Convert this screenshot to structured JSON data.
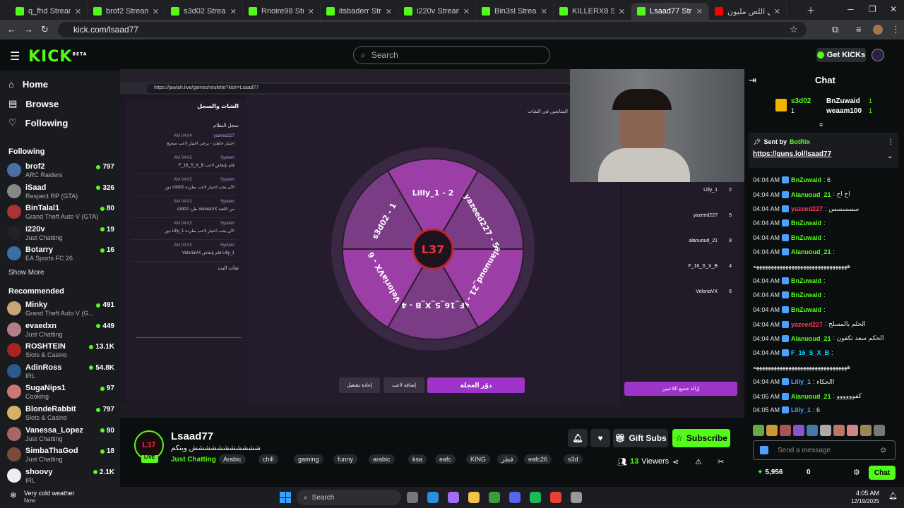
{
  "browser": {
    "tabs": [
      {
        "label": "q_fhd Stream - W",
        "type": "kick"
      },
      {
        "label": "brof2 Stream - W",
        "type": "kick"
      },
      {
        "label": "s3d02 Stream - W",
        "type": "kick"
      },
      {
        "label": "Rnoire98 Stream",
        "type": "kick"
      },
      {
        "label": "itsbaderr Stream",
        "type": "kick"
      },
      {
        "label": "i220v Stream - W",
        "type": "kick"
      },
      {
        "label": "Bin3sl Stream - W",
        "type": "kick"
      },
      {
        "label": "KILLERX8 Stream",
        "type": "kick"
      },
      {
        "label": "Lsaad77 Stream",
        "type": "kick",
        "active": true
      },
      {
        "label": "تحدي اللص مليون",
        "type": "youtube"
      }
    ],
    "url": "kick.com/lsaad77"
  },
  "header": {
    "logo": "KICK",
    "logo_sup": "BETA",
    "search_placeholder": "Search",
    "get_kicks": "Get KICKs"
  },
  "sidebar": {
    "nav": [
      {
        "label": "Home",
        "icon": "home-icon"
      },
      {
        "label": "Browse",
        "icon": "browse-icon"
      },
      {
        "label": "Following",
        "icon": "heart-icon"
      }
    ],
    "following_title": "Following",
    "following": [
      {
        "name": "brof2",
        "category": "ARC Raiders",
        "viewers": "797",
        "color": "#4a6fa5"
      },
      {
        "name": "iSaad",
        "category": "Respect RP (GTA)",
        "viewers": "326",
        "color": "#888"
      },
      {
        "name": "BinTalal1",
        "category": "Grand Theft Auto V (GTA)",
        "viewers": "80",
        "color": "#a33"
      },
      {
        "name": "i220v",
        "category": "Just Chatting",
        "viewers": "19",
        "color": "#222"
      },
      {
        "name": "Botarry",
        "category": "EA Sports FC 26",
        "viewers": "16",
        "color": "#3a6ea5"
      }
    ],
    "show_more": "Show More",
    "recommended_title": "Recommended",
    "recommended": [
      {
        "name": "Minky",
        "category": "Grand Theft Auto V (G...",
        "viewers": "491",
        "color": "#c9a57a"
      },
      {
        "name": "evaedxn",
        "category": "Just Chatting",
        "viewers": "449",
        "color": "#b57d8a"
      },
      {
        "name": "ROSHTEIN",
        "category": "Slots & Casino",
        "viewers": "13.1K",
        "color": "#a22"
      },
      {
        "name": "AdinRoss",
        "category": "IRL",
        "viewers": "54.8K",
        "color": "#2d5a8a"
      },
      {
        "name": "SugaNips1",
        "category": "Cooking",
        "viewers": "97",
        "color": "#c77"
      },
      {
        "name": "BlondeRabbit",
        "category": "Slots & Casino",
        "viewers": "797",
        "color": "#d4b26a"
      },
      {
        "name": "Vanessa_Lopez",
        "category": "Just Chatting",
        "viewers": "90",
        "color": "#a66"
      },
      {
        "name": "SimbaThaGod",
        "category": "Just Chatting",
        "viewers": "18",
        "color": "#7a4a3a"
      },
      {
        "name": "shoovy",
        "category": "IRL",
        "viewers": "2.1K",
        "color": "#eee"
      }
    ]
  },
  "stream_scene": {
    "inner_url": "https://jawlah.live/games/roulette?kick=Lsaad77",
    "left_header": "الشات والسجل",
    "left_sub": "سجل النظام",
    "chat_title": "شات البث",
    "wheel_segments": [
      {
        "label": "Lilly_1 - 2",
        "color": "#9b3fa6"
      },
      {
        "label": "yazeed227 - 5",
        "color": "#7b3c86"
      },
      {
        "label": "alanuoud_21 - 8",
        "color": "#9b3fa6"
      },
      {
        "label": "F_16_S_X_B - 4",
        "color": "#7b3c86"
      },
      {
        "label": "VeloriaVX - 6",
        "color": "#9b3fa6"
      },
      {
        "label": "s3d02 - 1",
        "color": "#7b3c86"
      }
    ],
    "wheel_center": "L37",
    "btn_spin": "دوّر العجلة",
    "btn_add": "إضافة لاعب",
    "btn_restart": "إعادة تشغيل",
    "btn_remove_all": "إزالة جميع اللاعبين",
    "players_header": "المتابعين في الشات",
    "players": [
      {
        "name": "Lilly_1",
        "num": "2"
      },
      {
        "name": "yazeed227",
        "num": "5"
      },
      {
        "name": "alanuoud_21",
        "num": "8"
      },
      {
        "name": "F_16_S_X_B",
        "num": "4"
      },
      {
        "name": "VeloriaVX",
        "num": "6"
      }
    ],
    "left_chat": [
      {
        "time": "AM 04:04",
        "user": "yazeed227",
        "text": "اختيار خاطئ - يرجى اختيار لاعب صحيح"
      },
      {
        "time": "AM 04:03",
        "user": "System",
        "text": "F_16_S_X_B قام بإنعاش لاعب"
      },
      {
        "time": "AM 04:03",
        "user": "System",
        "text": "دور s3d02 الآن يجب اختيار لاعب بطرده"
      },
      {
        "time": "AM 04:03",
        "user": "System",
        "text": "s3d02 طرد VeloriaVX من اللعبة"
      },
      {
        "time": "AM 04:03",
        "user": "System",
        "text": "دور Lilly_1 الآن يجب اختيار لاعب بطرده"
      },
      {
        "time": "AM 04:03",
        "user": "System",
        "text": "VeloriaVX قام بإنعاش Lilly_1"
      }
    ]
  },
  "streamer": {
    "name": "Lsaad77",
    "title": "ششششششششششش وينكم",
    "category": "Just Chatting",
    "tags": [
      "Arabic",
      "chill",
      "gaming",
      "funny",
      "arabic",
      "ksa",
      "eafc",
      "KING",
      "قطر",
      "eafc26",
      "s3d"
    ],
    "viewers": "13",
    "viewers_label": "Viewers",
    "live": "LIVE",
    "gift_subs": "Gift Subs",
    "subscribe": "Subscribe"
  },
  "chat": {
    "title": "Chat",
    "top": [
      {
        "name": "s3d02",
        "count": "1"
      },
      {
        "name": "BnZuwaid",
        "count": "1"
      },
      {
        "name": "weaam100",
        "count": "1"
      }
    ],
    "pinned_sent_by": "Sent by",
    "pinned_user": "BotRix",
    "pinned_link": "https://guns.lol/lsaad77",
    "messages": [
      {
        "time": "04:04 AM",
        "user": "BnZuwaid",
        "text": ": 6",
        "color": "#53fc18"
      },
      {
        "time": "04:04 AM",
        "user": "Alanuoud_21",
        "text": ": اح اح",
        "color": "#53fc18"
      },
      {
        "time": "04:04 AM",
        "user": "yazeed227",
        "text": ": سسسسس",
        "color": "#ff3b5c"
      },
      {
        "time": "04:04 AM",
        "user": "BnZuwaid",
        "text": ":",
        "color": "#53fc18"
      },
      {
        "time": "04:04 AM",
        "user": "BnZuwaid",
        "text": ":",
        "color": "#53fc18"
      },
      {
        "time": "04:04 AM",
        "user": "Alanuoud_21",
        "text": ":",
        "color": "#53fc18"
      },
      {
        "time": "",
        "user": "",
        "text": "ههههههههههههههههههههههههههههههههه",
        "color": "#e6e6e6"
      },
      {
        "time": "04:04 AM",
        "user": "BnZuwaid",
        "text": ":",
        "color": "#53fc18"
      },
      {
        "time": "04:04 AM",
        "user": "BnZuwaid",
        "text": ":",
        "color": "#53fc18"
      },
      {
        "time": "04:04 AM",
        "user": "BnZuwaid",
        "text": ":",
        "color": "#53fc18"
      },
      {
        "time": "04:04 AM",
        "user": "yazeed227",
        "text": ": الحلم بالمسلح",
        "color": "#ff3b5c"
      },
      {
        "time": "04:04 AM",
        "user": "Alanuoud_21",
        "text": ": الحكم سعد تكفون",
        "color": "#53fc18"
      },
      {
        "time": "04:04 AM",
        "user": "F_16_S_X_B",
        "text": ":",
        "color": "#00d9ff"
      },
      {
        "time": "",
        "user": "",
        "text": "ههههههههههههههههههههههههههههههههه",
        "color": "#e6e6e6"
      },
      {
        "time": "04:04 AM",
        "user": "Lilly_1",
        "text": ": الحكاء!",
        "color": "#4aa0ff"
      },
      {
        "time": "04:05 AM",
        "user": "Alanuoud_21",
        "text": ": كفوووووو",
        "color": "#53fc18"
      },
      {
        "time": "04:05 AM",
        "user": "Lilly_1",
        "text": ": 6",
        "color": "#4aa0ff"
      }
    ],
    "input_placeholder": "Send a message",
    "kicks_balance": "5,956",
    "points": "0",
    "send_label": "Chat"
  },
  "windows": {
    "weather": "Very cold weather",
    "weather_sub": "Now",
    "search": "Search",
    "time": "4:05 AM",
    "date": "12/19/2025"
  }
}
